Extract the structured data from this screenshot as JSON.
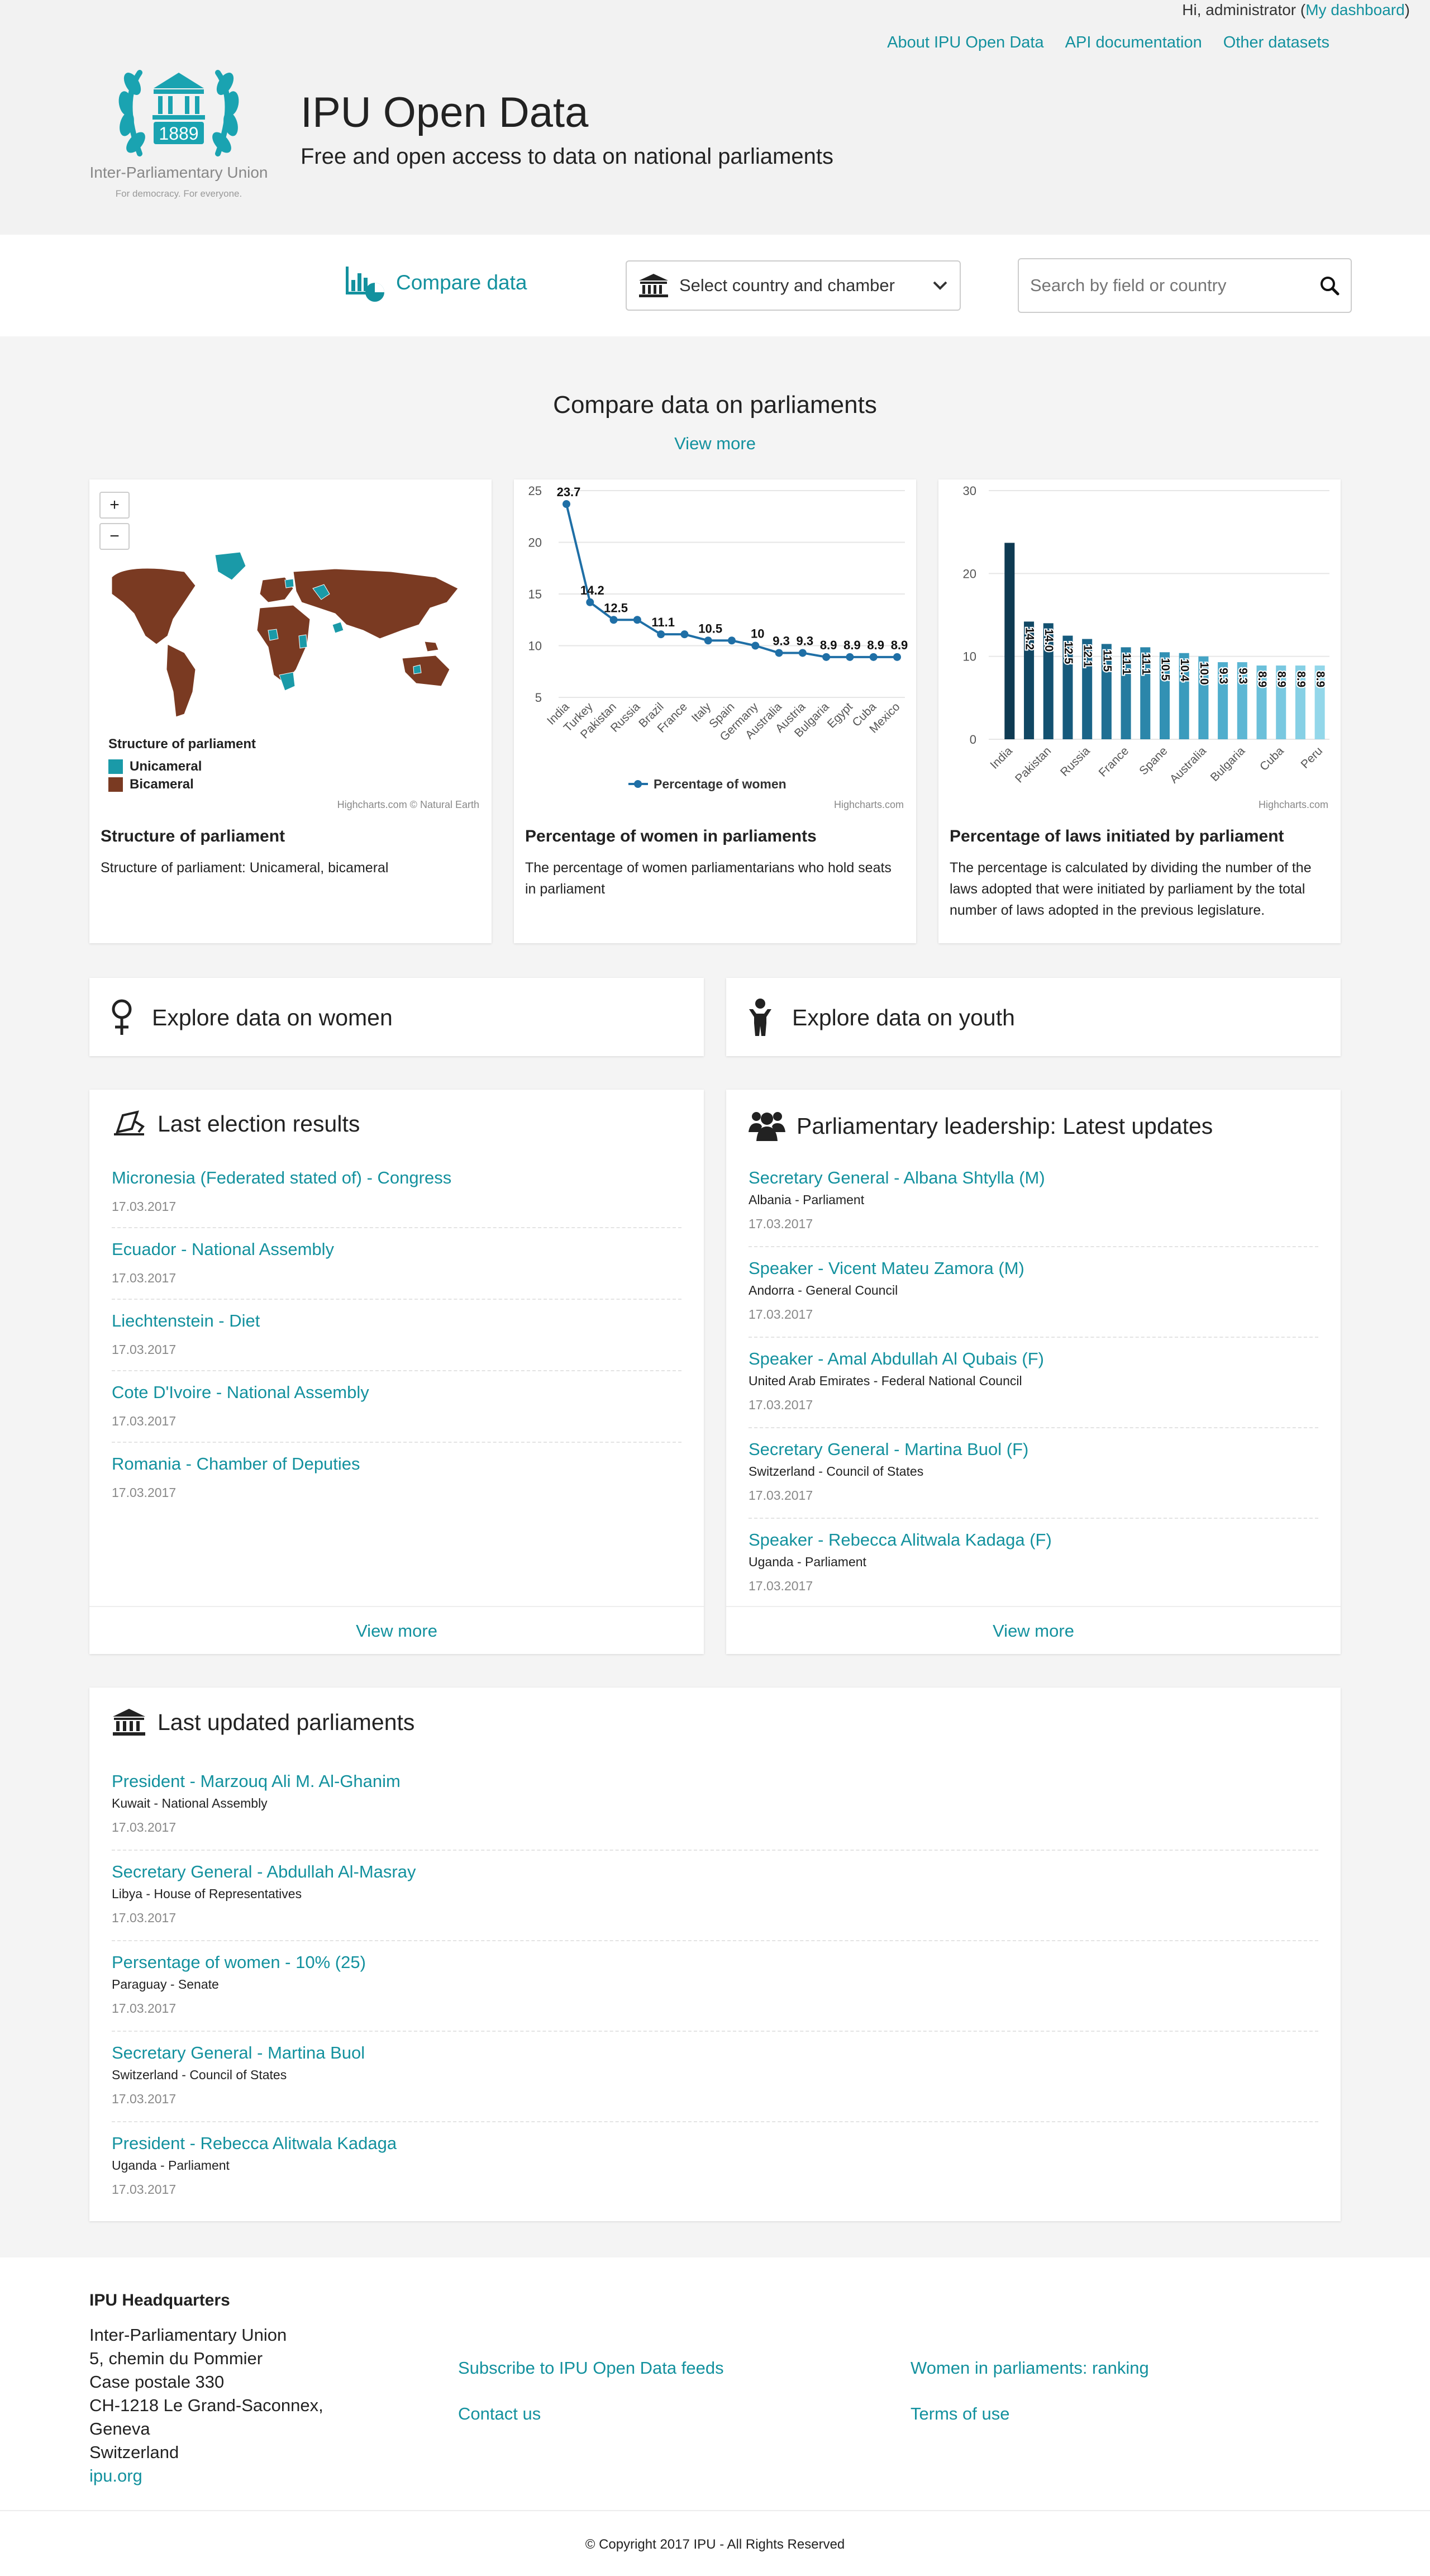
{
  "header": {
    "greeting": "Hi, administrator (",
    "dashboard_link": "My dashboard",
    "greeting_close": ")",
    "links": [
      "About IPU Open Data",
      "API documentation",
      "Other datasets"
    ],
    "logo_year": "1889",
    "logo_org": "Inter-Parliamentary Union",
    "logo_tagline": "For democracy. For everyone.",
    "title": "IPU Open Data",
    "subtitle": "Free and open access to data on national parliaments"
  },
  "toolbar": {
    "compare_label": "Compare data",
    "select_label": "Select country and chamber",
    "search_placeholder": "Search by field or country"
  },
  "compare_section": {
    "title": "Compare data on parliaments",
    "view_more": "View more"
  },
  "cards": [
    {
      "title": "Structure of parliament",
      "description": "Structure of parliament: Unicameral, bicameral",
      "credit": "Highcharts.com © Natural Earth",
      "map_legend_title": "Structure of parliament",
      "map_legend": [
        {
          "label": "Unicameral",
          "color": "#1a9aa8"
        },
        {
          "label": "Bicameral",
          "color": "#7a3a22"
        }
      ],
      "zoom_in": "+",
      "zoom_out": "−"
    },
    {
      "title": "Percentage of women in parliaments",
      "description": "The percentage of women parliamentarians who hold seats in parliament",
      "credit": "Highcharts.com"
    },
    {
      "title": "Percentage of laws initiated by parliament",
      "description": "The percentage is calculated by dividing the number of the laws adopted that were initiated by parliament by the total number of laws adopted in the previous legislature.",
      "credit": "Highcharts.com"
    }
  ],
  "chart_data": [
    {
      "type": "line",
      "categories": [
        "India",
        "Turkey",
        "Pakistan",
        "Russia",
        "Brazil",
        "France",
        "Italy",
        "Spain",
        "Germany",
        "Australia",
        "Austria",
        "Bulgaria",
        "Egypt",
        "Cuba",
        "Mexico"
      ],
      "series": [
        {
          "name": "Percentage of women",
          "values": [
            23.7,
            14.2,
            12.5,
            12.5,
            11.1,
            11.1,
            10.5,
            10.5,
            10,
            9.3,
            9.3,
            8.9,
            8.9,
            8.9,
            8.9
          ]
        }
      ],
      "data_labels": [
        "23.7",
        "14.2",
        "12.5",
        "",
        "11.1",
        "",
        "10.5",
        "",
        "10",
        "9.3",
        "9.3",
        "8.9",
        "8.9",
        "8.9",
        "8.9"
      ],
      "yticks": [
        5,
        10,
        15,
        20,
        25
      ],
      "ylim": [
        5,
        25
      ],
      "grid": true,
      "legend": "bottom",
      "color": "#1f6fa6"
    },
    {
      "type": "bar",
      "categories": [
        "India",
        "",
        "Pakistan",
        "",
        "Russia",
        "",
        "France",
        "",
        "Spane",
        "",
        "Australia",
        "",
        "Bulgaria",
        "",
        "Cuba",
        "",
        "Peru"
      ],
      "values": [
        23.7,
        14.2,
        14.0,
        12.5,
        12.1,
        11.5,
        11.1,
        11.1,
        10.5,
        10.4,
        10.0,
        9.3,
        9.3,
        8.9,
        8.9,
        8.9,
        8.9
      ],
      "bar_labels": [
        "",
        "14.2",
        "14.0",
        "12.5",
        "12.1",
        "11.5",
        "11.1",
        "11.1",
        "10.5",
        "10.4",
        "10.0",
        "9.3",
        "9.3",
        "8.9",
        "8.9",
        "8.9",
        "8.9"
      ],
      "yticks": [
        0,
        10,
        20,
        30
      ],
      "ylim": [
        0,
        30
      ],
      "grid": true,
      "colors": [
        "#0e3a52",
        "#114763",
        "#135170",
        "#165a7c",
        "#1a6488",
        "#1f6f93",
        "#257b9f",
        "#2b86aa",
        "#3291b4",
        "#3a9bbd",
        "#44a4c5",
        "#50aecd",
        "#5db7d4",
        "#6bc0da",
        "#79c8e0",
        "#86d0e5",
        "#93d7ea"
      ]
    }
  ],
  "explore": {
    "women": "Explore data on women",
    "youth": "Explore data on youth"
  },
  "elections": {
    "title": "Last election results",
    "items": [
      {
        "title": "Micronesia (Federated stated of) - Congress",
        "date": "17.03.2017"
      },
      {
        "title": "Ecuador - National Assembly",
        "date": "17.03.2017"
      },
      {
        "title": "Liechtenstein - Diet",
        "date": "17.03.2017"
      },
      {
        "title": "Cote D'Ivoire - National Assembly",
        "date": "17.03.2017"
      },
      {
        "title": "Romania - Chamber of Deputies",
        "date": "17.03.2017"
      }
    ],
    "view_more": "View more"
  },
  "leadership": {
    "title": "Parliamentary leadership: Latest updates",
    "items": [
      {
        "title": "Secretary General - Albana Shtylla (M)",
        "sub": "Albania - Parliament",
        "date": "17.03.2017"
      },
      {
        "title": "Speaker - Vicent Mateu Zamora (M)",
        "sub": "Andorra - General Council",
        "date": "17.03.2017"
      },
      {
        "title": "Speaker - Amal Abdullah Al Qubais (F)",
        "sub": "United Arab Emirates - Federal National Council",
        "date": "17.03.2017"
      },
      {
        "title": "Secretary General - Martina Buol (F)",
        "sub": "Switzerland - Council of States",
        "date": "17.03.2017"
      },
      {
        "title": "Speaker - Rebecca Alitwala Kadaga (F)",
        "sub": "Uganda - Parliament",
        "date": "17.03.2017"
      }
    ],
    "view_more": "View more"
  },
  "updated": {
    "title": "Last updated parliaments",
    "items": [
      {
        "title": "President - Marzouq Ali M. Al-Ghanim",
        "sub": "Kuwait - National Assembly",
        "date": "17.03.2017"
      },
      {
        "title": "Secretary General - Abdullah Al-Masray",
        "sub": "Libya - House of Representatives",
        "date": "17.03.2017"
      },
      {
        "title": "Persentage of women - 10% (25)",
        "sub": "Paraguay - Senate",
        "date": "17.03.2017"
      },
      {
        "title": "Secretary General - Martina Buol",
        "sub": "Switzerland - Council of States",
        "date": "17.03.2017"
      },
      {
        "title": "President - Rebecca Alitwala Kadaga",
        "sub": "Uganda - Parliament",
        "date": "17.03.2017"
      }
    ]
  },
  "footer": {
    "hq_title": "IPU Headquarters",
    "address": [
      "Inter-Parliamentary Union",
      "5, chemin du Pommier",
      "Case postale 330",
      "CH-1218 Le Grand-Saconnex,",
      "Geneva",
      "Switzerland"
    ],
    "site_link": "ipu.org",
    "links": [
      "Subscribe to IPU Open Data feeds",
      "Contact us",
      "Women in parliaments: ranking",
      "Terms of use"
    ],
    "copyright": "© Copyright 2017 IPU - All Rights Reserved"
  },
  "colors": {
    "accent": "#13919e",
    "unicameral": "#1a9aa8",
    "bicameral": "#7a3a22"
  }
}
